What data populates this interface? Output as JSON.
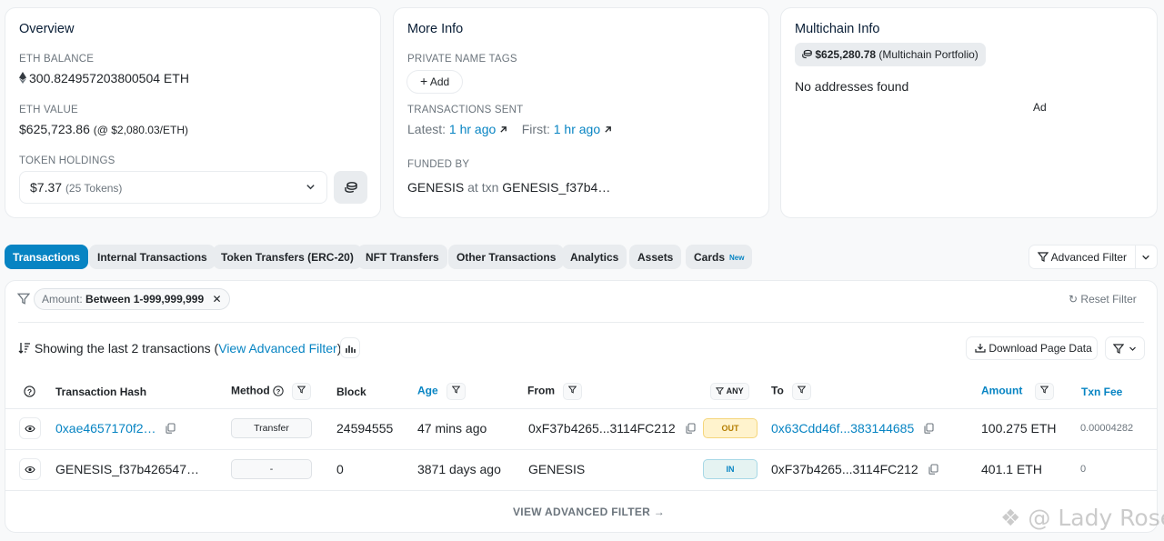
{
  "overview": {
    "title": "Overview",
    "eth_balance_label": "ETH BALANCE",
    "eth_balance": "300.824957203800504 ETH",
    "eth_value_label": "ETH VALUE",
    "eth_value": "$625,723.86",
    "eth_price": "(@ $2,080.03/ETH)",
    "token_holdings_label": "TOKEN HOLDINGS",
    "token_value": "$7.37",
    "token_count": "(25 Tokens)"
  },
  "more_info": {
    "title": "More Info",
    "name_tags_label": "PRIVATE NAME TAGS",
    "add_label": "Add",
    "tx_sent_label": "TRANSACTIONS SENT",
    "latest_label": "Latest:",
    "latest_value": "1 hr ago",
    "first_label": "First:",
    "first_value": "1 hr ago",
    "funded_by_label": "FUNDED BY",
    "funded_source": "GENESIS",
    "funded_at": "at txn",
    "funded_txn": "GENESIS_f37b4…"
  },
  "multichain": {
    "title": "Multichain Info",
    "portfolio_value": "$625,280.78",
    "portfolio_label": "(Multichain Portfolio)",
    "no_addresses": "No addresses found",
    "ad": "Ad"
  },
  "tabs": [
    {
      "label": "Transactions",
      "active": true
    },
    {
      "label": "Internal Transactions"
    },
    {
      "label": "Token Transfers (ERC-20)"
    },
    {
      "label": "NFT Transfers"
    },
    {
      "label": "Other Transactions"
    },
    {
      "label": "Analytics"
    },
    {
      "label": "Assets"
    },
    {
      "label": "Cards",
      "badge": "New"
    }
  ],
  "advanced_filter_label": "Advanced Filter",
  "filter": {
    "chip_key": "Amount:",
    "chip_value": "Between 1-999,999,999",
    "reset_label": "Reset Filter"
  },
  "summary": {
    "showing": "Showing the last 2 transactions (",
    "view_link": "View Advanced Filter",
    "close_paren": ")",
    "download_label": "Download Page Data"
  },
  "table": {
    "headers": {
      "hash": "Transaction Hash",
      "method": "Method",
      "block": "Block",
      "age": "Age",
      "from": "From",
      "any": "ANY",
      "to": "To",
      "amount": "Amount",
      "fee": "Txn Fee"
    },
    "rows": [
      {
        "hash": "0xae4657170f2…",
        "method": "Transfer",
        "block": "24594555",
        "age": "47 mins ago",
        "from": "0xF37b4265...3114FC212",
        "direction": "OUT",
        "to": "0x63Cdd46f...383144685",
        "amount": "100.275 ETH",
        "fee": "0.00004282"
      },
      {
        "hash": "GENESIS_f37b426547…",
        "method": "-",
        "block": "0",
        "age": "3871 days ago",
        "from": "GENESIS",
        "direction": "IN",
        "to": "0xF37b4265...3114FC212",
        "amount": "401.1 ETH",
        "fee": "0"
      }
    ]
  },
  "view_advanced_footer": "VIEW ADVANCED FILTER →",
  "watermark": "@ Lady Rose",
  "colors": {
    "accent": "#0784c3",
    "out_bg": "#fff3cd",
    "in_bg": "#e5f3f2"
  }
}
